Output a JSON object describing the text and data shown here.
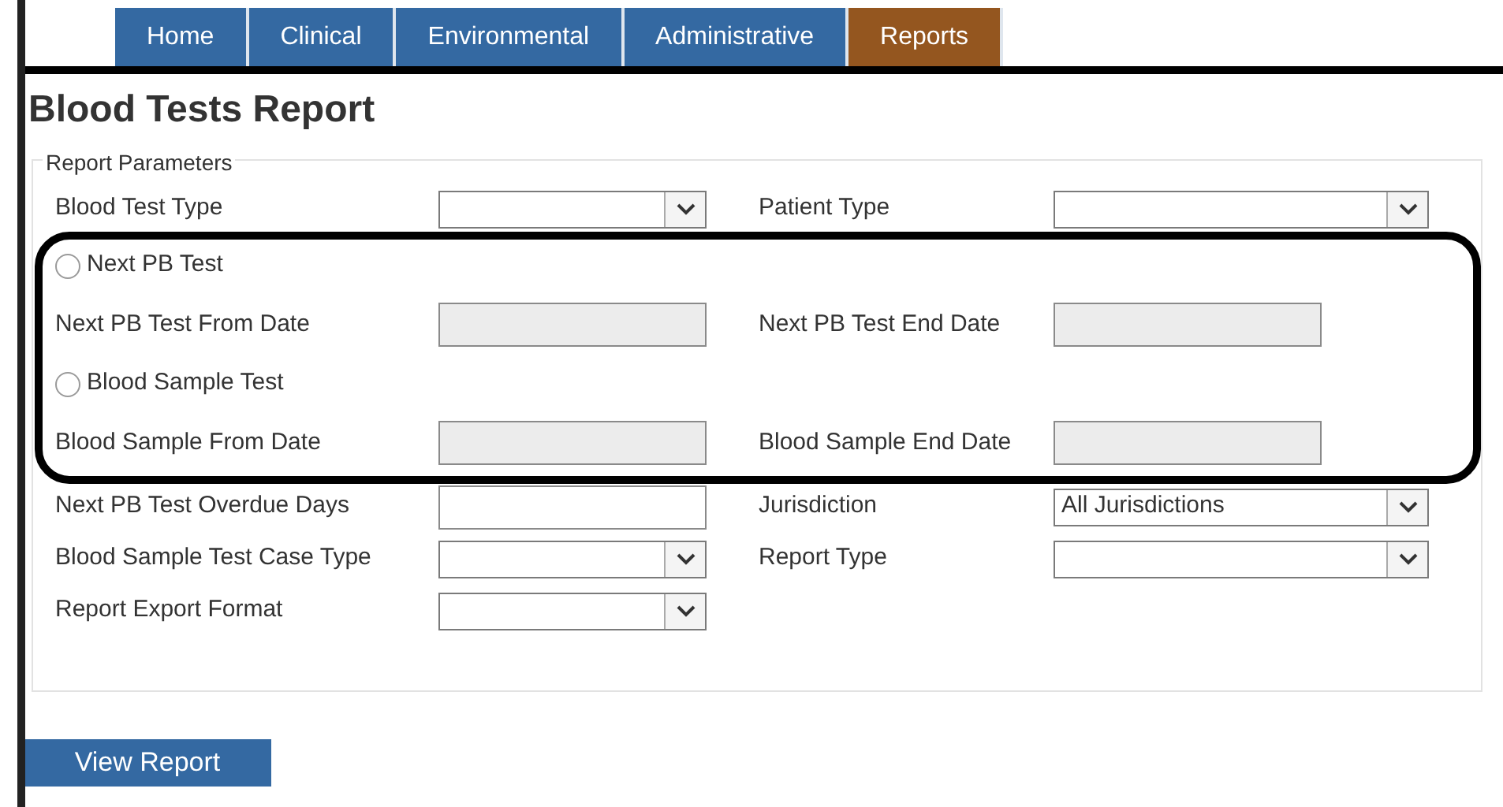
{
  "tabs": [
    {
      "label": "Home",
      "selected": false
    },
    {
      "label": "Clinical",
      "selected": false
    },
    {
      "label": "Environmental",
      "selected": false
    },
    {
      "label": "Administrative",
      "selected": false
    },
    {
      "label": "Reports",
      "selected": true
    }
  ],
  "title": "Blood Tests Report",
  "parameters": {
    "legend": "Report Parameters",
    "sections": [
      {
        "highlighted": false,
        "rows": [
          [
            {
              "kind": "select",
              "label": "Blood Test Type"
            },
            {
              "kind": "select",
              "label": "Patient Type"
            }
          ]
        ]
      },
      {
        "highlighted": true,
        "rows": [
          [
            {
              "kind": "radio",
              "label": "Next PB Test",
              "selected": false
            }
          ],
          [
            {
              "kind": "date",
              "label": "Next PB Test From Date",
              "disabled": true
            },
            {
              "kind": "date",
              "label": "Next PB Test End Date",
              "disabled": true
            }
          ],
          [
            {
              "kind": "radio",
              "label": "Blood Sample Test",
              "selected": false
            }
          ],
          [
            {
              "kind": "date",
              "label": "Blood Sample From Date",
              "disabled": true
            },
            {
              "kind": "date",
              "label": "Blood Sample End Date",
              "disabled": true
            }
          ]
        ]
      },
      {
        "highlighted": false,
        "rows": [
          [
            {
              "kind": "text",
              "label": "Next PB Test Overdue Days",
              "disabled": false
            },
            {
              "kind": "select",
              "label": "Jurisdiction",
              "value": "All Jurisdictions"
            }
          ],
          [
            {
              "kind": "select",
              "label": "Blood Sample Test Case Type"
            },
            {
              "kind": "select",
              "label": "Report Type"
            }
          ],
          [
            {
              "kind": "select",
              "label": "Report Export Format"
            }
          ]
        ]
      }
    ]
  },
  "button": "View Report"
}
